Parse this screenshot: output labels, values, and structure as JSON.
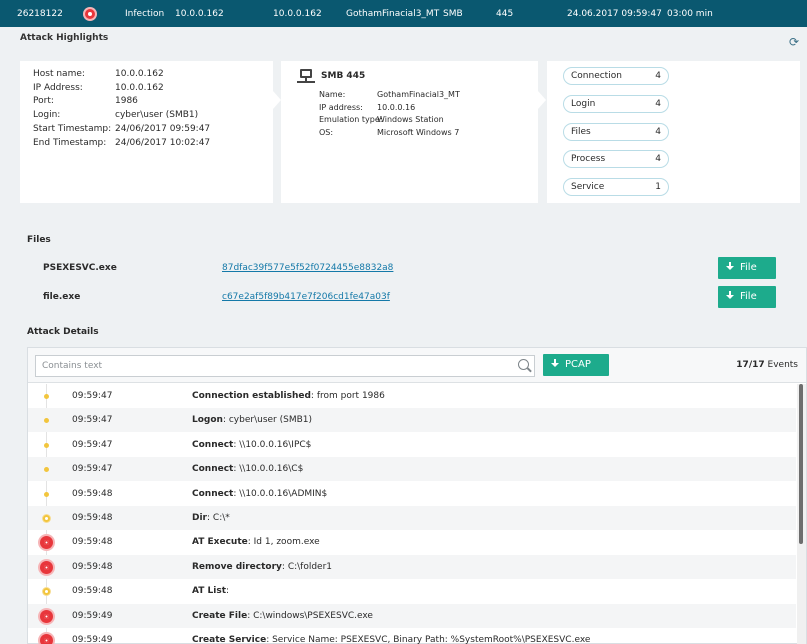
{
  "incident": {
    "id": "26218122",
    "type": "Infection",
    "source_ip": "10.0.0.162",
    "target_ip": "10.0.0.162",
    "target_name": "GothamFinacial3_MT",
    "protocol": "SMB",
    "port": "445",
    "timestamp": "24.06.2017 09:59:47",
    "duration": "03:00 min"
  },
  "highlights": {
    "title": "Attack Highlights",
    "attacker": [
      {
        "label": "Host name:",
        "value": "10.0.0.162"
      },
      {
        "label": "IP Address:",
        "value": "10.0.0.162"
      },
      {
        "label": "Port:",
        "value": "1986"
      },
      {
        "label": "Login:",
        "value": "cyber\\user (SMB1)"
      },
      {
        "label": "Start Timestamp:",
        "value": "24/06/2017 09:59:47"
      },
      {
        "label": "End Timestamp:",
        "value": "24/06/2017 10:02:47"
      }
    ],
    "service": {
      "title": "SMB 445",
      "fields": [
        {
          "label": "Name:",
          "value": "GothamFinacial3_MT"
        },
        {
          "label": "IP address:",
          "value": "10.0.0.16"
        },
        {
          "label": "Emulation type:",
          "value": "Windows Station"
        },
        {
          "label": "OS:",
          "value": "Microsoft Windows 7"
        }
      ]
    },
    "counts": [
      {
        "label": "Connection",
        "count": "4"
      },
      {
        "label": "Login",
        "count": "4"
      },
      {
        "label": "Files",
        "count": "4"
      },
      {
        "label": "Process",
        "count": "4"
      },
      {
        "label": "Service",
        "count": "1"
      }
    ]
  },
  "files": {
    "title": "Files",
    "items": [
      {
        "name": "PSEXESVC.exe",
        "hash": "87dfac39f577e5f52f0724455e8832a8",
        "button": "File"
      },
      {
        "name": "file.exe",
        "hash": "c67e2af5f89b417e7f206cd1fe47a03f",
        "button": "File"
      }
    ]
  },
  "details": {
    "title": "Attack Details",
    "search_placeholder": "Contains text",
    "pcap_button": "PCAP",
    "events_count": "17/17",
    "events_label": "Events",
    "rows": [
      {
        "time": "09:59:47",
        "action": "Connection established",
        "detail": " from port 1986",
        "severity": "low"
      },
      {
        "time": "09:59:47",
        "action": "Logon",
        "detail": " cyber\\user (SMB1)",
        "severity": "low"
      },
      {
        "time": "09:59:47",
        "action": "Connect",
        "detail": " \\\\10.0.0.16\\IPC$",
        "severity": "low"
      },
      {
        "time": "09:59:47",
        "action": "Connect",
        "detail": " \\\\10.0.0.16\\C$",
        "severity": "low"
      },
      {
        "time": "09:59:48",
        "action": "Connect",
        "detail": " \\\\10.0.0.16\\ADMIN$",
        "severity": "low"
      },
      {
        "time": "09:59:48",
        "action": "Dir",
        "detail": " C:\\*",
        "severity": "medium"
      },
      {
        "time": "09:59:48",
        "action": "AT Execute",
        "detail": " Id 1, zoom.exe",
        "severity": "high"
      },
      {
        "time": "09:59:48",
        "action": "Remove directory",
        "detail": " C:\\folder1",
        "severity": "high"
      },
      {
        "time": "09:59:48",
        "action": "AT List",
        "detail": "",
        "severity": "medium"
      },
      {
        "time": "09:59:49",
        "action": "Create File",
        "detail": " C:\\windows\\PSEXESVC.exe",
        "severity": "high"
      },
      {
        "time": "09:59:49",
        "action": "Create Service",
        "detail": " Service Name: PSEXESVC, Binary Path: %SystemRoot%\\PSEXESVC.exe",
        "severity": "high"
      }
    ]
  },
  "colors": {
    "topbar": "#0a5870",
    "accent_green": "#1dab8c",
    "link": "#1479a8",
    "severity_high": "#e8363b",
    "severity_low": "#f2c53d"
  }
}
